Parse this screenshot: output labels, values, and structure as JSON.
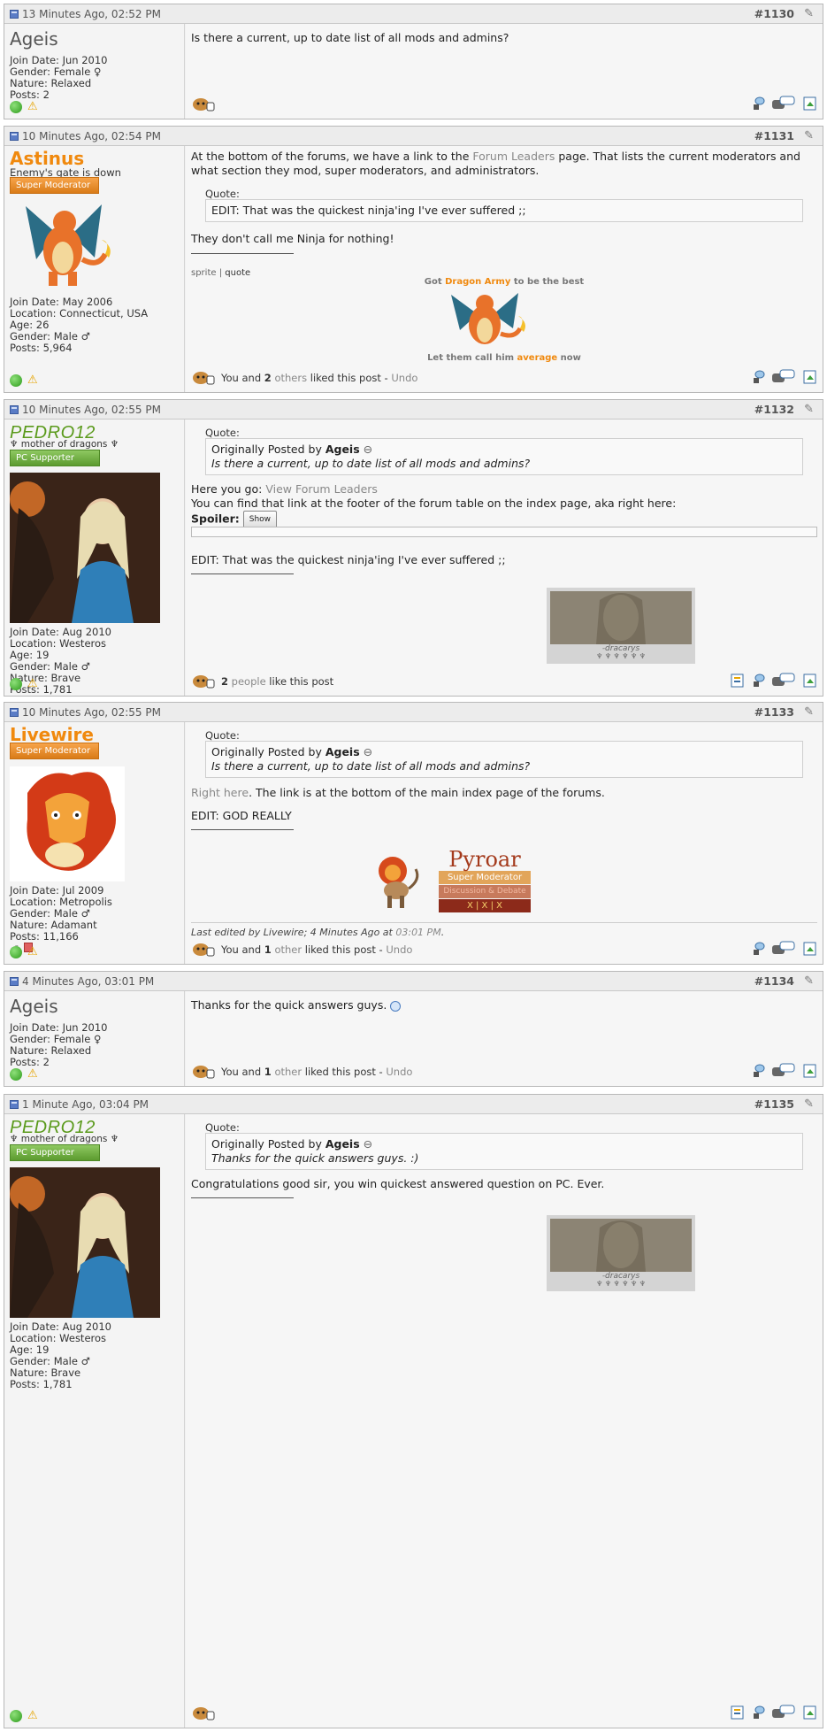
{
  "posts": [
    {
      "date": "13 Minutes Ago, 02:52 PM",
      "number": "#1130",
      "user": {
        "name": "Ageis",
        "details": [
          "Join Date: Jun 2010",
          "Gender: Female ♀",
          "Nature: Relaxed",
          "Posts: 2"
        ]
      },
      "text": "Is there a current, up to date list of all mods and admins?"
    },
    {
      "date": "10 Minutes Ago, 02:54 PM",
      "number": "#1131",
      "user": {
        "name": "Astinus",
        "title": "Enemy's gate is down",
        "rank": "Super Moderator",
        "details": [
          "Join Date: May 2006",
          "Location: Connecticut, USA",
          "Age: 26",
          "Gender: Male ♂",
          "Posts: 5,964"
        ]
      },
      "text_pre": "At the bottom of the forums, we have a link to the ",
      "text_link": "Forum Leaders",
      "text_post": " page. That lists the current moderators and what section they mod, super moderators, and administrators.",
      "quote_label": "Quote:",
      "quote_text": "EDIT: That was the quickest ninja'ing I've ever suffered ;;",
      "reply": "They don't call me Ninja for nothing!",
      "sig_links": {
        "a": "sprite",
        "sep": "|",
        "b": "quote"
      },
      "sig_top_a": "Got ",
      "sig_top_b": "Dragon Army",
      "sig_top_c": " to be the best",
      "sig_bottom_a": "Let them call him ",
      "sig_bottom_b": "average",
      "sig_bottom_c": " now",
      "likes": {
        "a": "You and ",
        "b": "2",
        "c": " others",
        "d": " liked this post - ",
        "e": "Undo"
      }
    },
    {
      "date": "10 Minutes Ago, 02:55 PM",
      "number": "#1132",
      "user": {
        "name": "PEDRO12",
        "title": "♆ mother of dragons ♆",
        "rank": "PC Supporter",
        "details": [
          "Join Date: Aug 2010",
          "Location: Westeros",
          "Age: 19",
          "Gender: Male ♂",
          "Nature: Brave",
          "Posts: 1,781"
        ]
      },
      "quote_label": "Quote:",
      "quote_orig": "Originally Posted by ",
      "quote_author": "Ageis",
      "quote_text": "Is there a current, up to date list of all mods and admins?",
      "line1_a": "Here you go: ",
      "line1_link": "View Forum Leaders",
      "line2": "You can find that link at the footer of the forum table on the index page, aka right here:",
      "spoiler_label": "Spoiler:",
      "spoiler_btn": "Show",
      "edit": "EDIT: That was the quickest ninja'ing I've ever suffered ;;",
      "sig_caption": "-dracarys",
      "sig_sub": "♆ ♆ ♆ ♆ ♆ ♆",
      "likes": {
        "a": "2",
        "b": " people",
        "c": " like this post"
      }
    },
    {
      "date": "10 Minutes Ago, 02:55 PM",
      "number": "#1133",
      "user": {
        "name": "Livewire",
        "rank": "Super Moderator",
        "details": [
          "Join Date: Jul 2009",
          "Location: Metropolis",
          "Gender: Male ♂",
          "Nature: Adamant",
          "Posts: 11,166"
        ]
      },
      "quote_label": "Quote:",
      "quote_orig": "Originally Posted by ",
      "quote_author": "Ageis",
      "quote_text": "Is there a current, up to date list of all mods and admins?",
      "line1_link": "Right here",
      "line1_rest": ". The link is at the bottom of the main index page of the forums.",
      "edit": "EDIT: GOD REALLY",
      "sig_title": "Pyroar",
      "sig_rank": "Super Moderator",
      "sig_sub": "Discussion & Debate",
      "sig_x": "X | X | X",
      "edited_a": "Last edited by Livewire; 4 Minutes Ago at ",
      "edited_b": "03:01 PM",
      "edited_c": ".",
      "likes": {
        "a": "You and ",
        "b": "1",
        "c": " other",
        "d": " liked this post - ",
        "e": "Undo"
      }
    },
    {
      "date": "4 Minutes Ago, 03:01 PM",
      "number": "#1134",
      "user": {
        "name": "Ageis",
        "details": [
          "Join Date: Jun 2010",
          "Gender: Female ♀",
          "Nature: Relaxed",
          "Posts: 2"
        ]
      },
      "text": "Thanks for the quick answers guys.",
      "likes": {
        "a": "You and ",
        "b": "1",
        "c": " other",
        "d": " liked this post - ",
        "e": "Undo"
      }
    },
    {
      "date": "1 Minute Ago, 03:04 PM",
      "number": "#1135",
      "user": {
        "name": "PEDRO12",
        "title": "♆ mother of dragons ♆",
        "rank": "PC Supporter",
        "details": [
          "Join Date: Aug 2010",
          "Location: Westeros",
          "Age: 19",
          "Gender: Male ♂",
          "Nature: Brave",
          "Posts: 1,781"
        ]
      },
      "quote_label": "Quote:",
      "quote_orig": "Originally Posted by ",
      "quote_author": "Ageis",
      "quote_text": "Thanks for the quick answers guys. :)",
      "text": "Congratulations good sir, you win quickest answered question on PC. Ever.",
      "sig_caption": "-dracarys",
      "sig_sub": "♆ ♆ ♆ ♆ ♆ ♆"
    }
  ],
  "colors": {
    "accent_orange": "#f0890e",
    "pc_green": "#5a9a1b",
    "online": "#2c9a1a"
  },
  "icons": [
    "post-icon",
    "edit-pencil-icon",
    "online-icon",
    "warning-icon",
    "like-icon",
    "reputation-icon",
    "report-icon",
    "quote-icon",
    "multiquote-icon",
    "blog-icon"
  ]
}
